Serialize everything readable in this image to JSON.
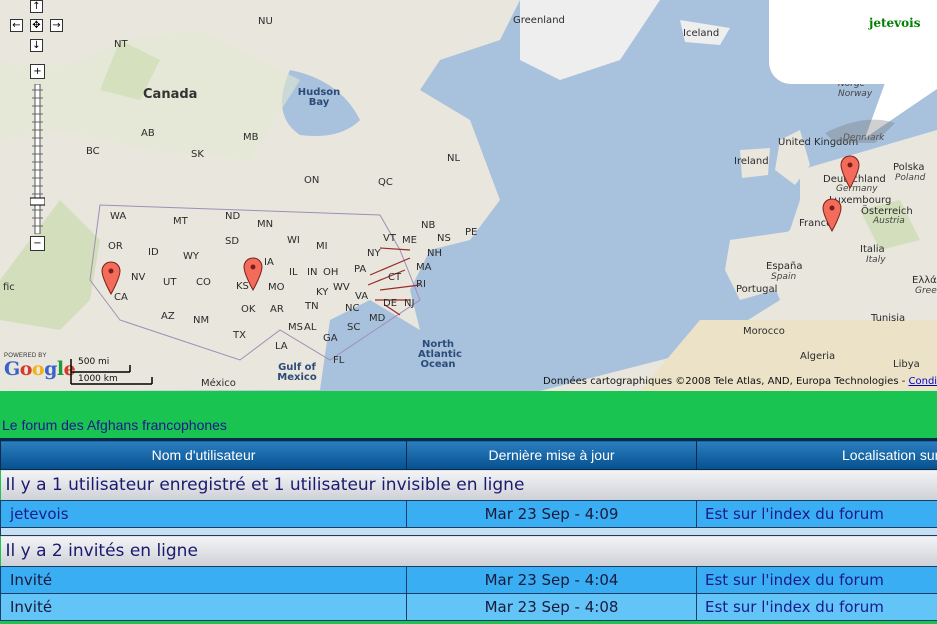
{
  "map": {
    "regions": [
      {
        "name": "Canada",
        "type": "big"
      },
      {
        "name": "Greenland",
        "type": "plain"
      },
      {
        "name": "Iceland",
        "type": "plain"
      },
      {
        "name": "Hudson Bay",
        "type": "water"
      },
      {
        "name": "North Atlantic Ocean",
        "type": "water"
      },
      {
        "name": "Gulf of Mexico",
        "type": "water"
      },
      {
        "name": "México",
        "type": "plain"
      },
      {
        "name": "United Kingdom",
        "type": "plain"
      },
      {
        "name": "Ireland",
        "type": "plain"
      },
      {
        "name": "Deutschland",
        "type": "plain"
      },
      {
        "name": "Germany",
        "type": "sub"
      },
      {
        "name": "Polska",
        "type": "plain"
      },
      {
        "name": "Poland",
        "type": "sub"
      },
      {
        "name": "Norge",
        "type": "sub"
      },
      {
        "name": "Norway",
        "type": "sub"
      },
      {
        "name": "Denmark",
        "type": "sub"
      },
      {
        "name": "Österreich",
        "type": "plain"
      },
      {
        "name": "Austria",
        "type": "sub"
      },
      {
        "name": "Italia",
        "type": "plain"
      },
      {
        "name": "Italy",
        "type": "sub"
      },
      {
        "name": "España",
        "type": "plain"
      },
      {
        "name": "Spain",
        "type": "sub"
      },
      {
        "name": "Portugal",
        "type": "plain"
      },
      {
        "name": "Morocco",
        "type": "plain"
      },
      {
        "name": "Algeria",
        "type": "plain"
      },
      {
        "name": "Tunisia",
        "type": "plain"
      },
      {
        "name": "Libya",
        "type": "plain"
      },
      {
        "name": "Ελλάδα",
        "type": "plain"
      },
      {
        "name": "Gree",
        "type": "sub"
      },
      {
        "name": "France",
        "type": "plain"
      },
      {
        "name": "Luxembourg",
        "type": "plain"
      },
      {
        "name": "fic",
        "type": "plain"
      }
    ],
    "states": [
      "NU",
      "NT",
      "AB",
      "BC",
      "SK",
      "MB",
      "ON",
      "QC",
      "NL",
      "NB",
      "PE",
      "NS",
      "WA",
      "MT",
      "ND",
      "MN",
      "WI",
      "MI",
      "OR",
      "ID",
      "WY",
      "SD",
      "IA",
      "IL",
      "IN",
      "OH",
      "NY",
      "VT",
      "ME",
      "NH",
      "MA",
      "CT",
      "RI",
      "PA",
      "NJ",
      "DE",
      "MD",
      "VA",
      "WV",
      "KY",
      "NV",
      "UT",
      "CO",
      "KS",
      "MO",
      "CA",
      "AZ",
      "NM",
      "OK",
      "AR",
      "TN",
      "NC",
      "SC",
      "TX",
      "LA",
      "MS",
      "AL",
      "GA",
      "FL"
    ],
    "attribution": "Données cartographiques ©2008 Tele Atlas, AND, Europa Technologies -",
    "attribution_link": "Conditions",
    "logo_powered": "POWERED BY",
    "logo_text": "Google",
    "scale_mi": "500 mi",
    "scale_km": "1000 km",
    "zoom_in": "+",
    "zoom_out": "−",
    "pan_up": "↑",
    "pan_down": "↓",
    "pan_left": "←",
    "pan_right": "→",
    "pan_center": "✥",
    "bubble_username": "jetevois",
    "colors": {
      "water": "#a8c1dd",
      "land": "#e9e6dd",
      "green": "#c9dcae",
      "pin": "#f26b5b"
    }
  },
  "forum_title": "Le forum des Afghans francophones",
  "table": {
    "headers": [
      "Nom d'utilisateur",
      "Dernière mise à jour",
      "Localisation sur le forum"
    ],
    "group1": "Il y a 1 utilisateur enregistré et 1 utilisateur invisible en ligne",
    "group2": "Il y a 2 invités en ligne",
    "rows_group1": [
      {
        "name": "jetevois",
        "date": "Mar 23 Sep - 4:09",
        "location": "Est sur l'index du forum"
      }
    ],
    "rows_group2": [
      {
        "name": "Invité",
        "date": "Mar 23 Sep - 4:04",
        "location": "Est sur l'index du forum"
      },
      {
        "name": "Invité",
        "date": "Mar 23 Sep - 4:08",
        "location": "Est sur l'index du forum"
      }
    ]
  }
}
